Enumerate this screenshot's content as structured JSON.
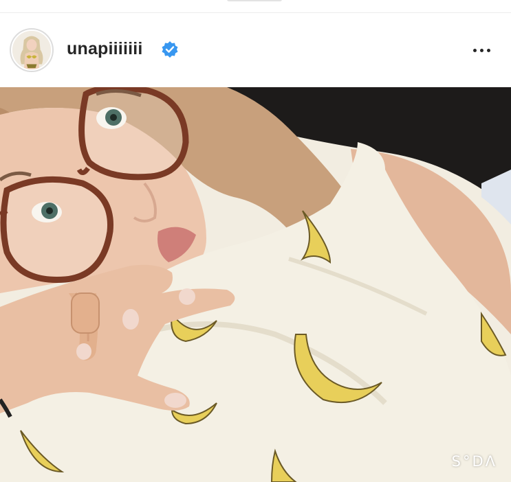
{
  "post": {
    "username": "unapiiiiiii",
    "verified": true,
    "verified_icon": "verified-badge-icon",
    "more_icon": "more-options-icon"
  },
  "photo": {
    "watermark": "S°DΛ",
    "description_icon": "selfie-photo"
  },
  "colors": {
    "verified_blue": "#3897f0",
    "username_text": "#262626",
    "shirt": "#f4f0e4",
    "banana": "#e8cf5a"
  }
}
